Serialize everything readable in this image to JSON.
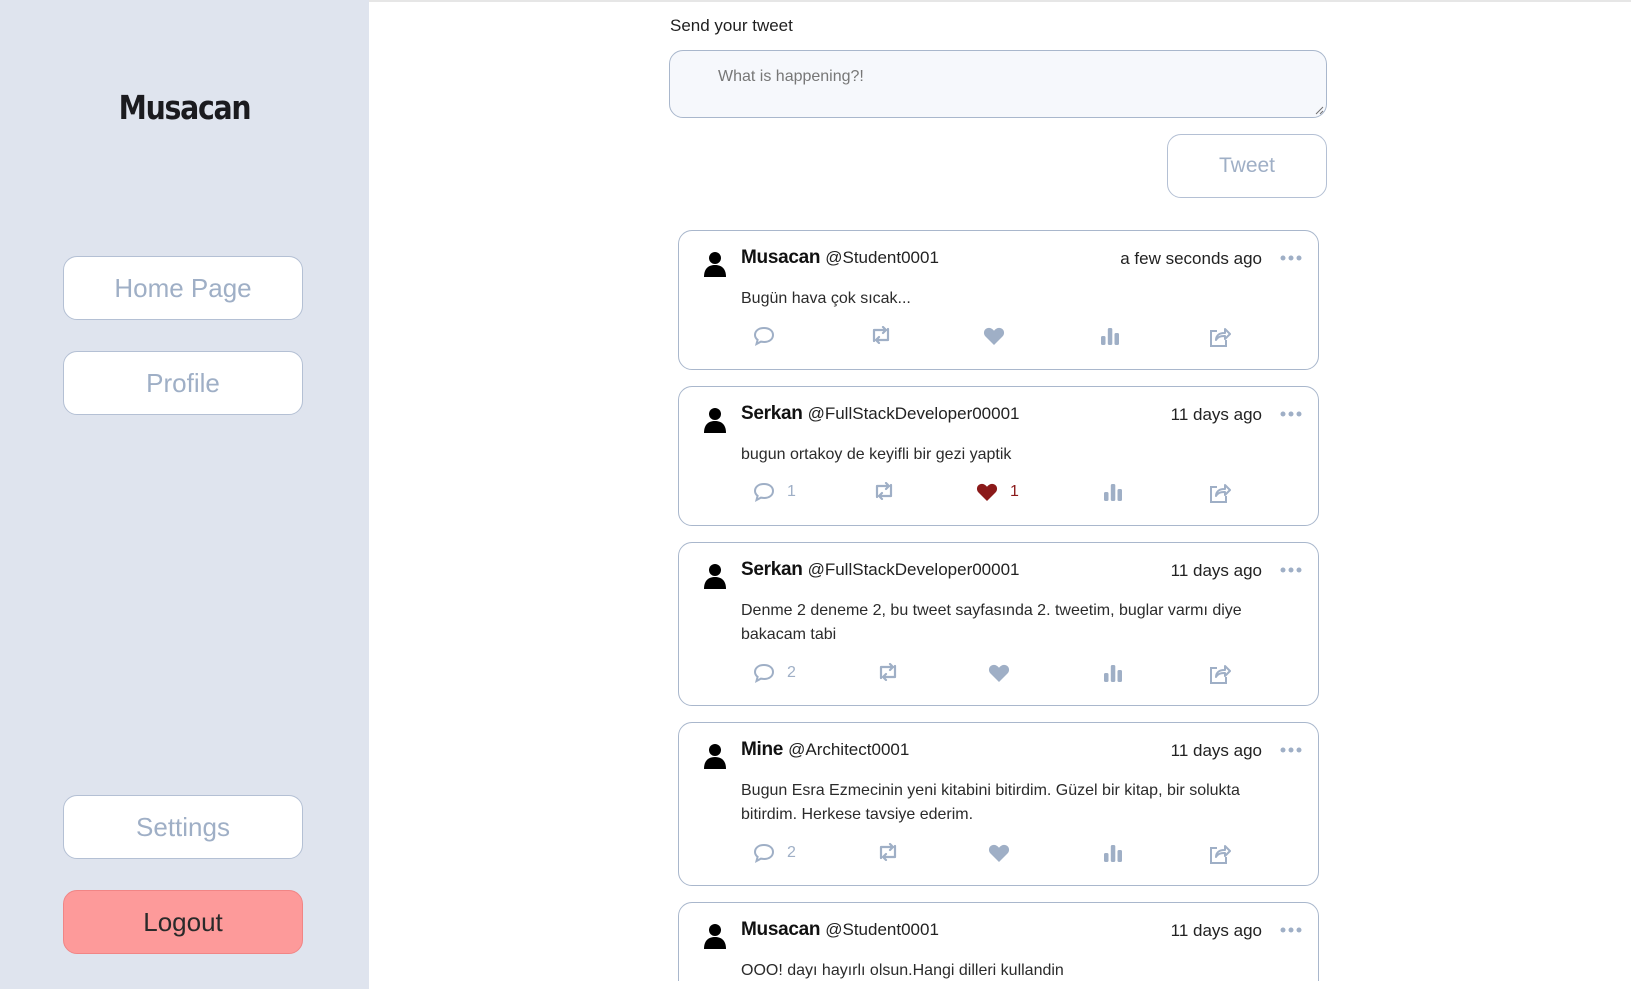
{
  "sidebar": {
    "brand": "Musacan",
    "home_label": "Home Page",
    "profile_label": "Profile",
    "settings_label": "Settings",
    "logout_label": "Logout"
  },
  "compose": {
    "label": "Send your tweet",
    "placeholder": "What is happening?!",
    "button_label": "Tweet"
  },
  "colors": {
    "sidebar_bg": "#dfe4ee",
    "accent_icon": "#9fafc6",
    "liked": "#8b1a1a",
    "logout_bg": "#fd9a9a"
  },
  "tweets": [
    {
      "name": "Musacan",
      "handle": "@Student0001",
      "time": "a few seconds ago",
      "text": "Bugün hava çok sıcak...",
      "comments": "",
      "likes": "",
      "liked": false
    },
    {
      "name": "Serkan",
      "handle": "@FullStackDeveloper00001",
      "time": "11 days ago",
      "text": "bugun ortakoy de keyifli bir gezi yaptik",
      "comments": "1",
      "likes": "1",
      "liked": true
    },
    {
      "name": "Serkan",
      "handle": "@FullStackDeveloper00001",
      "time": "11 days ago",
      "text": "Denme 2 deneme 2, bu tweet sayfasında 2. tweetim, buglar varmı diye bakacam tabi",
      "comments": "2",
      "likes": "",
      "liked": false
    },
    {
      "name": "Mine",
      "handle": "@Architect0001",
      "time": "11 days ago",
      "text": "Bugun Esra Ezmecinin yeni kitabini bitirdim. Güzel bir kitap, bir solukta bitirdim. Herkese tavsiye ederim.",
      "comments": "2",
      "likes": "",
      "liked": false
    },
    {
      "name": "Musacan",
      "handle": "@Student0001",
      "time": "11 days ago",
      "text": "OOO! dayı hayırlı olsun.Hangi dilleri kullandin",
      "comments": "",
      "likes": "",
      "liked": false
    }
  ],
  "icons": {
    "avatar": "user-icon",
    "more": "more-horizontal-icon",
    "comment": "comment-icon",
    "retweet": "retweet-icon",
    "like": "heart-icon",
    "stats": "stats-icon",
    "share": "share-icon"
  }
}
